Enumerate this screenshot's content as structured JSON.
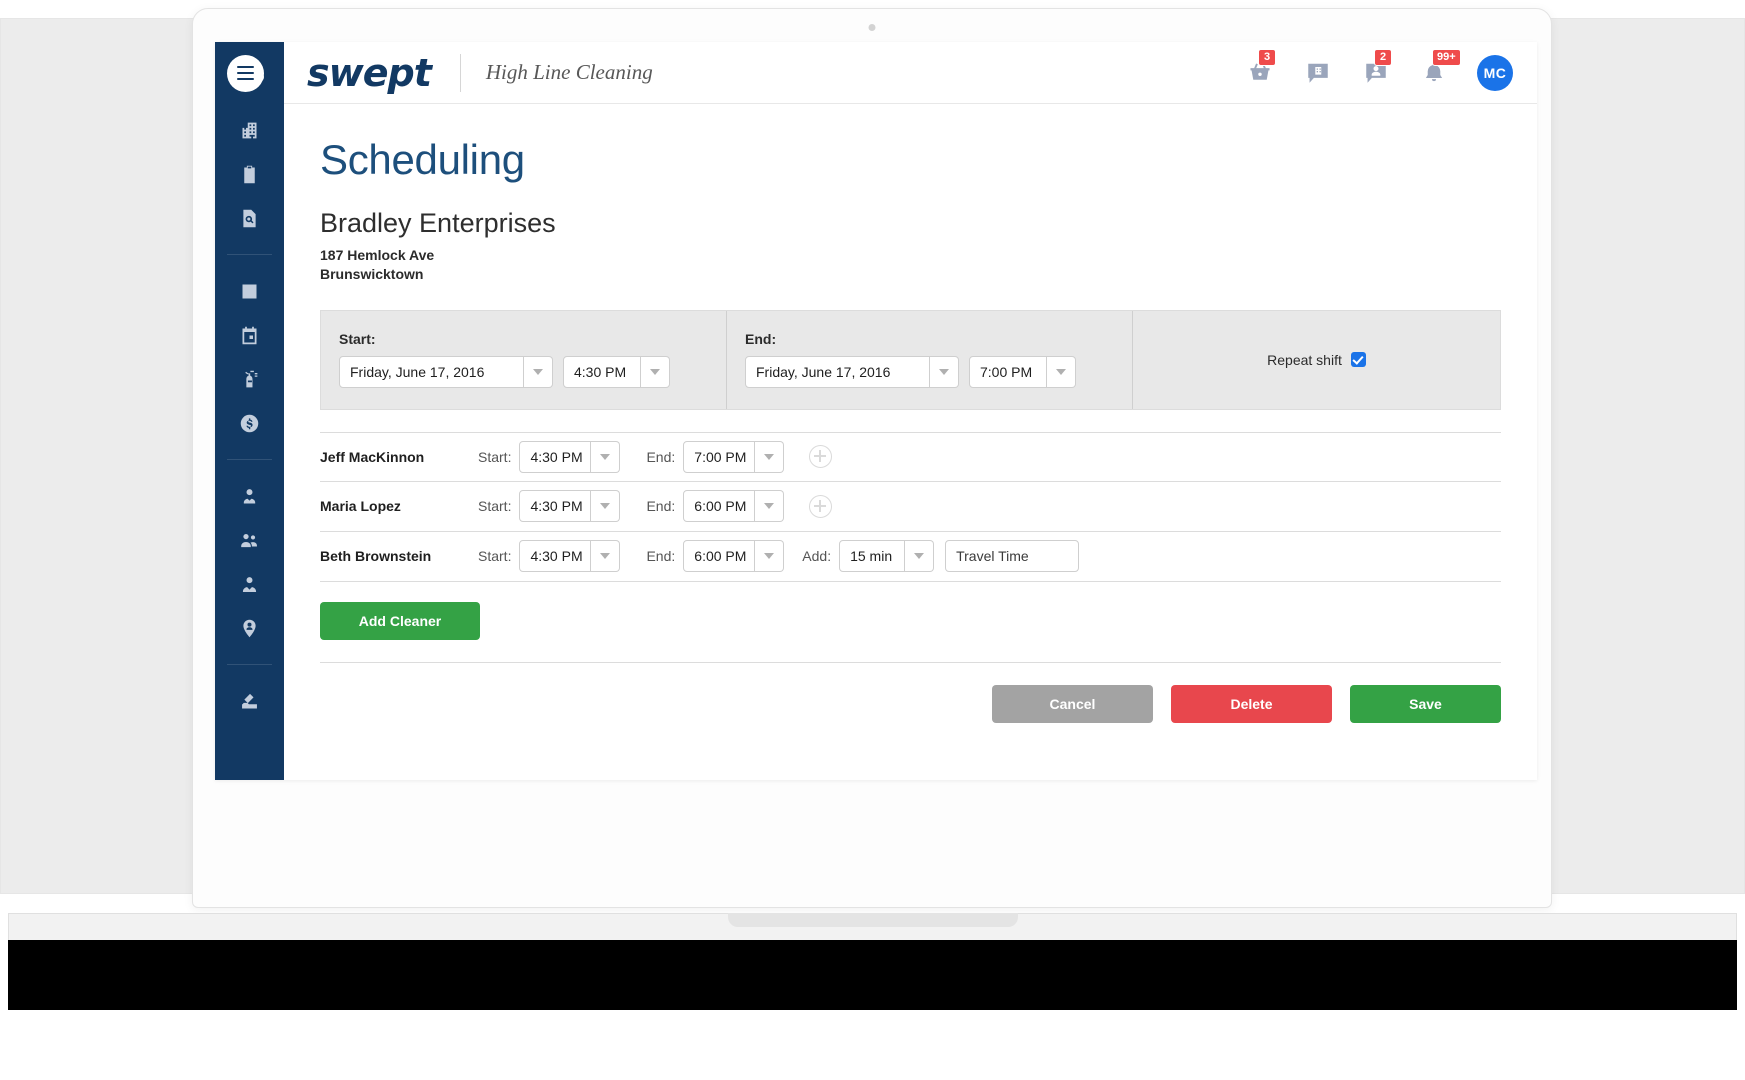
{
  "brand": {
    "logo_text": "swept",
    "tenant": "High Line Cleaning"
  },
  "topbar": {
    "icons": [
      {
        "name": "basket-icon",
        "badge": "3"
      },
      {
        "name": "building-message-icon",
        "badge": ""
      },
      {
        "name": "person-message-icon",
        "badge": "2"
      },
      {
        "name": "bell-icon",
        "badge": "99+"
      }
    ],
    "avatar_initials": "MC"
  },
  "sidebar": {
    "menu_icon": "hamburger-icon",
    "items": [
      {
        "name": "buildings-icon"
      },
      {
        "name": "clipboard-icon"
      },
      {
        "name": "document-search-icon"
      },
      {
        "name": "bar-chart-icon"
      },
      {
        "name": "calendar-icon"
      },
      {
        "name": "spray-bottle-icon"
      },
      {
        "name": "dollar-circle-icon"
      },
      {
        "name": "person-badge-icon"
      },
      {
        "name": "people-group-icon"
      },
      {
        "name": "person-team-icon"
      },
      {
        "name": "location-pin-person-icon"
      },
      {
        "name": "inbox-tray-icon"
      }
    ]
  },
  "page": {
    "title": "Scheduling",
    "site_name": "Bradley Enterprises",
    "address_line1": "187 Hemlock Ave",
    "address_line2": "Brunswicktown"
  },
  "shift": {
    "start_label": "Start:",
    "start_date": "Friday, June 17, 2016",
    "start_time": "4:30 PM",
    "end_label": "End:",
    "end_date": "Friday, June 17, 2016",
    "end_time": "7:00 PM",
    "repeat_label": "Repeat shift",
    "repeat_checked": true
  },
  "cleaners": {
    "start_label": "Start:",
    "end_label": "End:",
    "add_label": "Add:",
    "travel_placeholder": "Travel Time",
    "rows": [
      {
        "name": "Jeff MacKinnon",
        "start": "4:30 PM",
        "end": "7:00 PM",
        "has_add": false
      },
      {
        "name": "Maria Lopez",
        "start": "4:30 PM",
        "end": "6:00 PM",
        "has_add": false
      },
      {
        "name": "Beth Brownstein",
        "start": "4:30 PM",
        "end": "6:00 PM",
        "has_add": true,
        "add_value": "15 min"
      }
    ]
  },
  "actions": {
    "add_cleaner": "Add Cleaner",
    "cancel": "Cancel",
    "delete": "Delete",
    "save": "Save"
  },
  "colors": {
    "navy": "#123963",
    "title_blue": "#1d4f7c",
    "green": "#34a245",
    "red": "#e8474d",
    "grey": "#a3a3a3",
    "badge_red": "#ef4b4b",
    "avatar_blue": "#1a73e8"
  }
}
